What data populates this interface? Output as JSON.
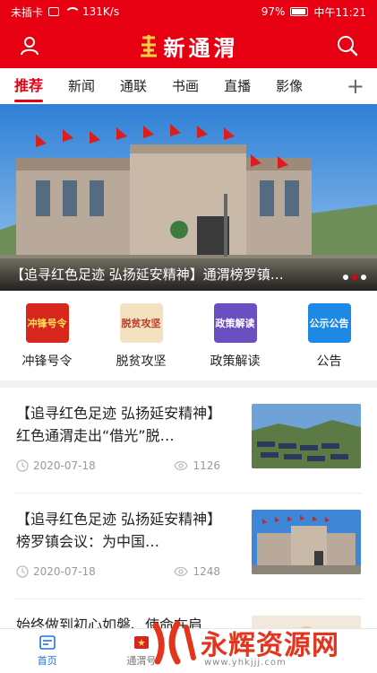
{
  "status_bar": {
    "carrier": "未插卡",
    "speed": "131K/s",
    "battery": "97%",
    "time": "中午11:21"
  },
  "header": {
    "logo_text": "新通渭",
    "user_icon": "user-icon",
    "search_icon": "search-icon",
    "brand_color": "#e60012"
  },
  "tabs": [
    {
      "label": "推荐",
      "active": true
    },
    {
      "label": "新闻"
    },
    {
      "label": "通联"
    },
    {
      "label": "书画"
    },
    {
      "label": "直播"
    },
    {
      "label": "影像"
    }
  ],
  "tab_add_label": "+",
  "banner": {
    "caption": "【追寻红色足迹 弘扬延安精神】通渭榜罗镇…"
  },
  "quick_links": [
    {
      "label": "冲锋号令",
      "img_text": "冲锋号令"
    },
    {
      "label": "脱贫攻坚",
      "img_text": "脱贫攻坚"
    },
    {
      "label": "政策解读",
      "img_text": "政策解读"
    },
    {
      "label": "公告",
      "img_text": "公示公告"
    }
  ],
  "news": [
    {
      "title": "【追寻红色足迹 弘扬延安精神】红色通渭走出“借光”脱…",
      "date": "2020-07-18",
      "views": "1126"
    },
    {
      "title": "【追寻红色足迹 弘扬延安精神】榜罗镇会议：为中国…",
      "date": "2020-07-18",
      "views": "1248"
    },
    {
      "title": "始终做到初心如磐、使命在肩…",
      "date": "",
      "views": ""
    }
  ],
  "bottom_nav": [
    {
      "label": "首页",
      "active": true
    },
    {
      "label": "通渭号"
    },
    {
      "label": ""
    },
    {
      "label": ""
    }
  ],
  "watermark": {
    "text": "永辉资源网",
    "url": "www.yhkjjj.com"
  }
}
